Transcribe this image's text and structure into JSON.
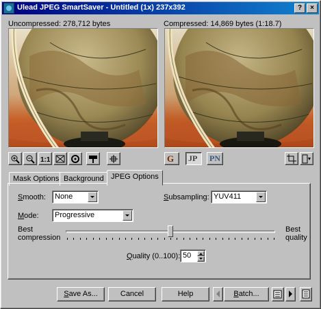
{
  "window": {
    "title": "Ulead JPEG SmartSaver - Untitled (1x) 237x392",
    "help_label": "?",
    "close_label": "×"
  },
  "previews": {
    "original_label": "Uncompressed: 278,712 bytes",
    "compressed_label": "Compressed: 14,869 bytes (1:18.7)"
  },
  "format_buttons": {
    "gif": "G",
    "jpeg": "JP",
    "png": "PN",
    "selected": "jpeg"
  },
  "tabs": [
    {
      "label": "Mask Options"
    },
    {
      "label": "Background"
    },
    {
      "label": "JPEG Options"
    }
  ],
  "active_tab": "JPEG Options",
  "jpeg_options": {
    "smooth_label": "Smooth:",
    "smooth_value": "None",
    "subsampling_label": "Subsampling:",
    "subsampling_value": "YUV411",
    "mode_label": "Mode:",
    "mode_value": "Progressive",
    "best_compression_label_1": "Best",
    "best_compression_label_2": "compression",
    "best_quality_label_1": "Best",
    "best_quality_label_2": "quality",
    "quality_label": "Quality (0..100):",
    "quality_value": "50",
    "quality_range": [
      0,
      100
    ]
  },
  "buttons": {
    "save_as": "Save As...",
    "cancel": "Cancel",
    "help": "Help",
    "batch": "Batch..."
  },
  "colors": {
    "title_start": "#000080",
    "title_end": "#1084d0",
    "face": "#c0c0c0"
  }
}
